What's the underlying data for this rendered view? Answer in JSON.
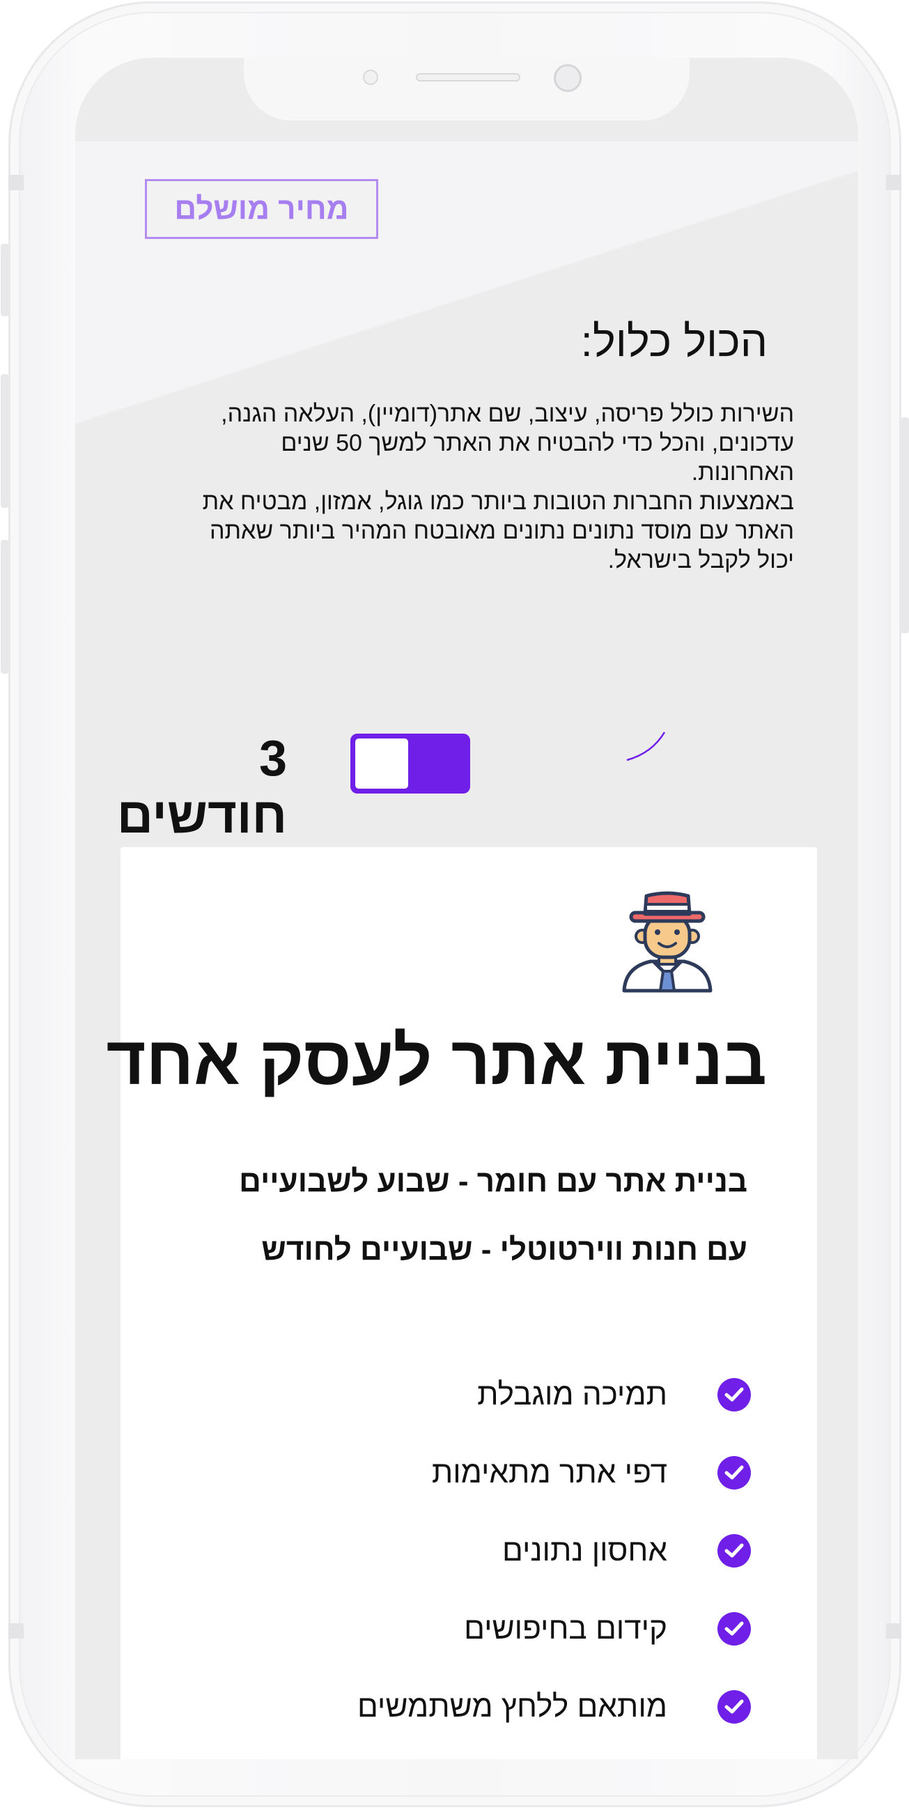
{
  "header": {
    "price_button": "מחיר מושלם"
  },
  "included": {
    "title": "הכול כלול:",
    "description": [
      "השירות כולל פריסה, עיצוב, שם אתר(דומיין), העלאה הגנה, עדכונים, והכל כדי להבטיח את האתר למשך 50 שנים האחרונות.",
      "באמצעות החברות הטובות ביותר כמו גוגל, אמזון, מבטיח את האתר עם מוסד נתונים נתונים מאובטח המהיר ביותר שאתה יכול לקבל בישראל."
    ]
  },
  "billing": {
    "toggle_label": "3 חודשים",
    "toggle_state": "on"
  },
  "plan": {
    "icon": "businessman-avatar-icon",
    "title": "בניית אתר לעסק אחד",
    "subtitle_1": "בניית אתר עם חומר - שבוע לשבועיים",
    "subtitle_2": "עם חנות ווירטוטלי - שבועיים לחודש",
    "features": [
      "תמיכה מוגבלת",
      "דפי אתר מתאימות",
      "אחסון נתונים",
      "קידום בחיפושים",
      "מותאם ללחץ משתמשים"
    ]
  },
  "colors": {
    "accent": "#6f1fe8",
    "accent_light": "#a77ef0",
    "screen_bg": "#ececec"
  }
}
